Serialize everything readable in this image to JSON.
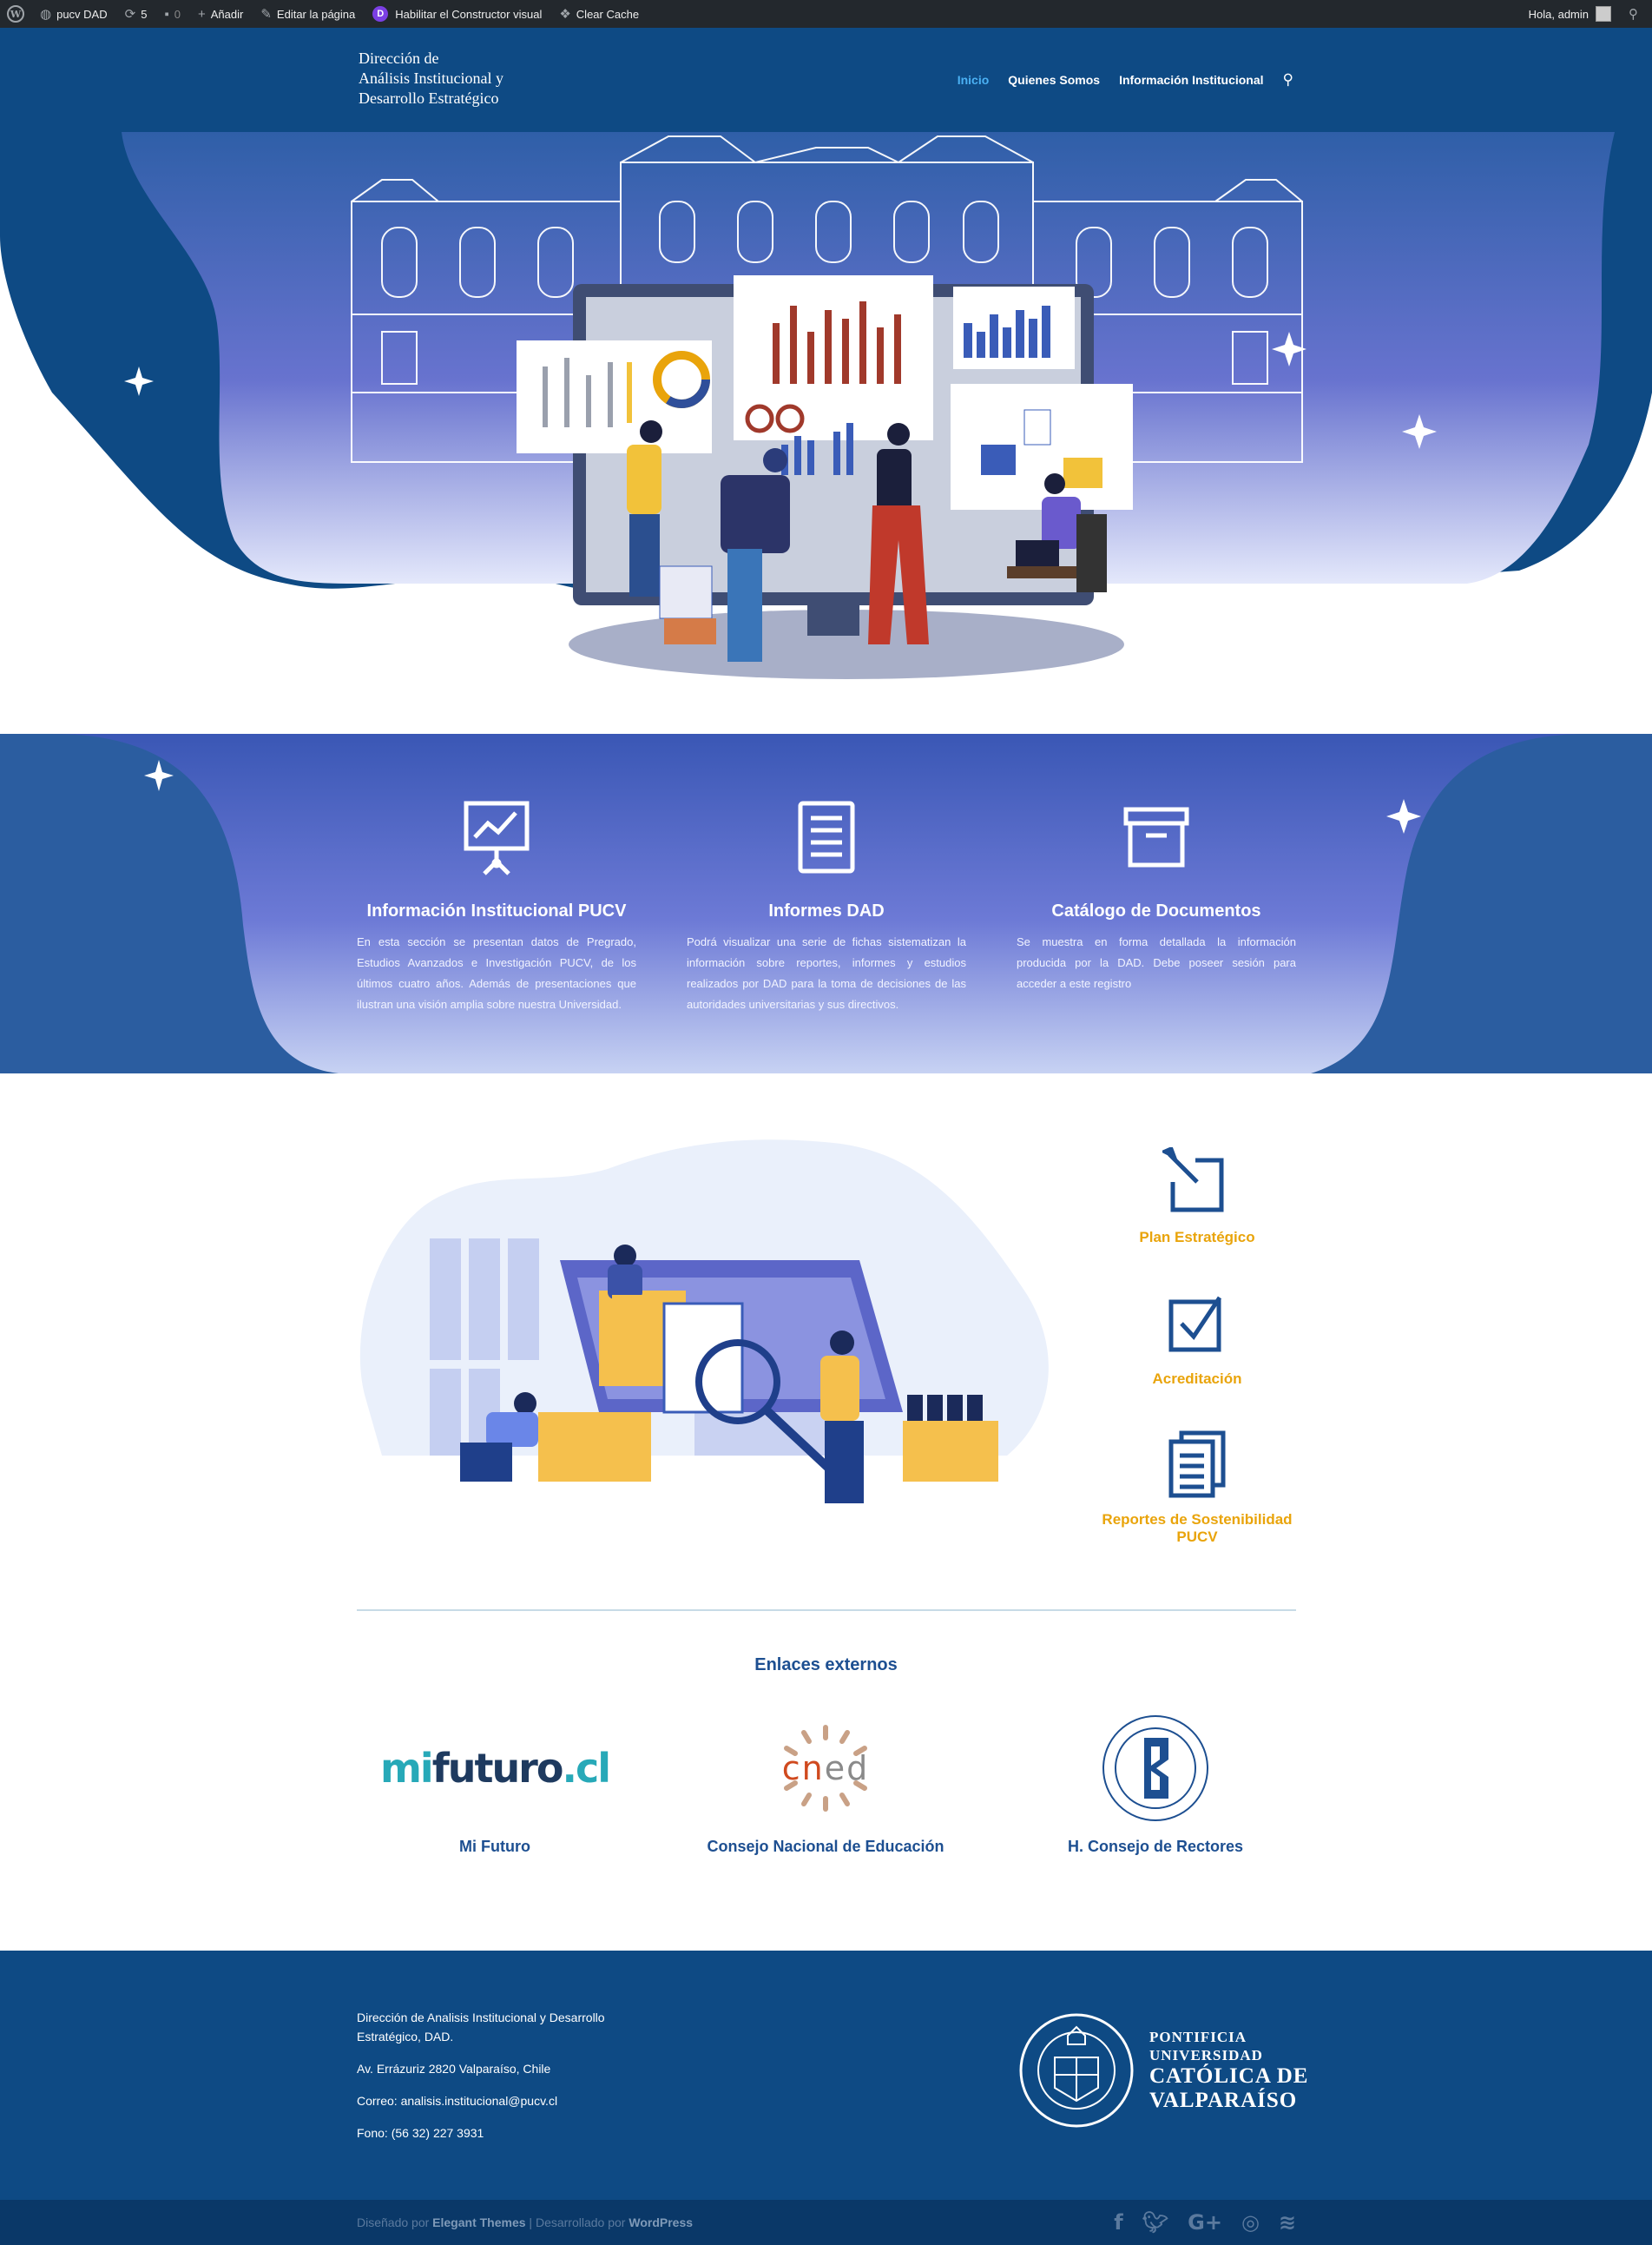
{
  "admin_bar": {
    "site_name": "pucv DAD",
    "updates_count": "5",
    "comments_count": "0",
    "add_new": "Añadir",
    "edit_page": "Editar la página",
    "visual_builder": "Habilitar el Constructor visual",
    "clear_cache": "Clear Cache",
    "greeting": "Hola, admin"
  },
  "header": {
    "logo_line1": "Dirección de",
    "logo_line2": "Análisis Institucional y",
    "logo_line3": "Desarrollo Estratégico",
    "nav": [
      "Inicio",
      "Quienes Somos",
      "Información Institucional"
    ]
  },
  "features": [
    {
      "title": "Información Institucional PUCV",
      "text": "En esta sección se presentan datos de Pregrado, Estudios Avanzados e Investigación PUCV, de los últimos cuatro años. Además de presentaciones que ilustran una visión amplia sobre nuestra Universidad.",
      "icon": "presentation-chart-icon"
    },
    {
      "title": "Informes DAD",
      "text": "Podrá visualizar una serie de fichas sistematizan la información sobre reportes, informes y estudios realizados por DAD para la toma de decisiones de las autoridades universitarias y sus directivos.",
      "icon": "document-icon"
    },
    {
      "title": "Catálogo de Documentos",
      "text": "Se muestra en forma detallada la información producida por la DAD. Debe poseer sesión para acceder a este registro",
      "icon": "archive-box-icon"
    }
  ],
  "side_links": [
    {
      "label": "Plan Estratégico",
      "icon": "edit-icon"
    },
    {
      "label": "Acreditación",
      "icon": "checkbox-icon"
    },
    {
      "label": "Reportes de Sostenibilidad PUCV",
      "icon": "documents-icon"
    }
  ],
  "external": {
    "title": "Enlaces externos",
    "links": [
      {
        "label": "Mi Futuro",
        "logo_text_a": "mi",
        "logo_text_b": "futuro",
        "logo_text_c": ".cl"
      },
      {
        "label": "Consejo Nacional de Educación",
        "logo_text_a": "cn",
        "logo_text_b": "ed"
      },
      {
        "label": "H. Consejo de Rectores"
      }
    ]
  },
  "footer": {
    "address_title": "Dirección de Analisis Institucional y Desarrollo Estratégico, DAD.",
    "address": "Av. Errázuriz 2820 Valparaíso, Chile",
    "email": "Correo: analisis.institucional@pucv.cl",
    "phone": "Fono: (56 32) 227 3931",
    "pucv_line1": "PONTIFICIA",
    "pucv_line2": "UNIVERSIDAD",
    "pucv_line3": "CATÓLICA DE",
    "pucv_line4": "VALPARAÍSO"
  },
  "bottom": {
    "designed_by": "Diseñado por",
    "elegant": "Elegant Themes",
    "separator": " | Desarrollado por ",
    "wordpress": "WordPress",
    "social_icons": [
      "facebook-icon",
      "twitter-icon",
      "google-plus-icon",
      "instagram-icon",
      "rss-icon"
    ]
  },
  "colors": {
    "header_blue": "#0e4a84",
    "light_blue": "#4bb1f4",
    "accent_orange": "#e9a40b",
    "heading_blue": "#1d4f91"
  }
}
